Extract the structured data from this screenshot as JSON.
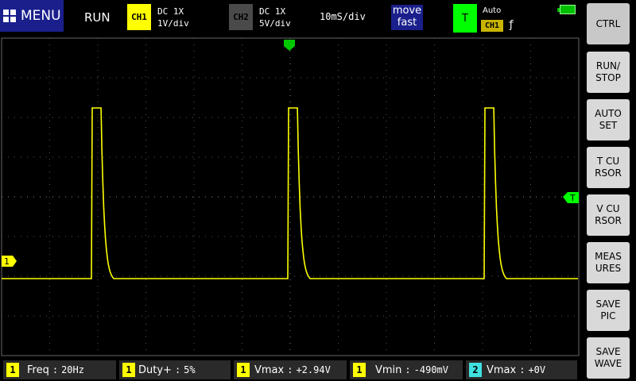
{
  "topbar": {
    "menu_label": "MENU",
    "run_status": "RUN",
    "ch1": {
      "badge": "CH1",
      "coupling": "DC  1X",
      "scale": "1V/div",
      "color": "#ffff00"
    },
    "ch2": {
      "badge": "CH2",
      "coupling": "DC  1X",
      "scale": "5V/div",
      "color": "#4a4a4a"
    },
    "timebase": "10mS/div",
    "move": {
      "line1": "move",
      "line2": "fast"
    },
    "trigger": {
      "badge": "T",
      "mode": "Auto",
      "source": "CH1",
      "edge": "ƒ",
      "color": "#00ff00"
    }
  },
  "screen": {
    "trigger_position_marker": "T",
    "ch1_marker": "1",
    "waveform": {
      "color": "#ffff00",
      "description_free": true,
      "period_ms": 40,
      "pulse_width_ms": 2,
      "high_level_div": 4.3,
      "baseline_div": 0
    }
  },
  "sidebar": {
    "buttons": [
      "CTRL",
      "RUN/\nSTOP",
      "AUTO\nSET",
      "T  CU\nRSOR",
      "V  CU\nRSOR",
      "MEAS\nURES",
      "SAVE\nPIC",
      "SAVE\nWAVE"
    ]
  },
  "measurements": [
    {
      "ch": "1",
      "label": "Freq",
      "value": "20Hz",
      "color": "#ffff00"
    },
    {
      "ch": "1",
      "label": "Duty+",
      "value": "5%",
      "color": "#ffff00"
    },
    {
      "ch": "1",
      "label": "Vmax",
      "value": "+2.94V",
      "color": "#ffff00"
    },
    {
      "ch": "1",
      "label": "Vmin",
      "value": "-490mV",
      "color": "#ffff00"
    },
    {
      "ch": "2",
      "label": "Vmax",
      "value": "+0V",
      "color": "#40e0e0"
    }
  ]
}
